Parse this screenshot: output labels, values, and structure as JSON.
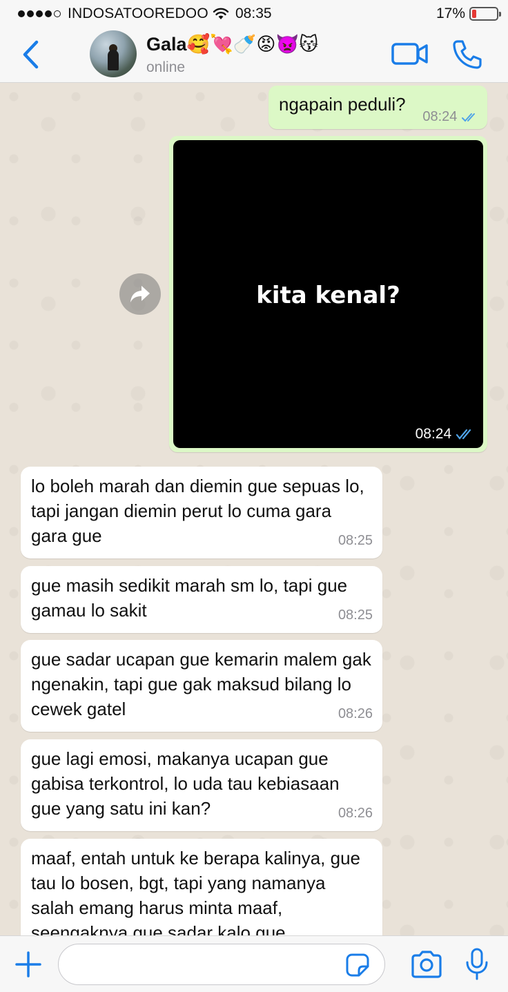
{
  "status_bar": {
    "carrier": "INDOSATOOREDOO",
    "time": "08:35",
    "battery_percent": "17%",
    "battery_level": 0.17
  },
  "header": {
    "contact_name": "Gala🥰💘🍼😡👿😽",
    "contact_status": "online"
  },
  "messages": {
    "out_1": {
      "text": "ngapain peduli?",
      "time": "08:24",
      "status": "read"
    },
    "out_2": {
      "caption": "kita kenal?",
      "time": "08:24",
      "status": "read"
    },
    "in": [
      {
        "text": "lo boleh marah dan diemin gue sepuas lo, tapi jangan diemin perut lo cuma gara gara gue",
        "time": "08:25"
      },
      {
        "text": "gue masih sedikit marah sm lo, tapi gue gamau lo sakit",
        "time": "08:25"
      },
      {
        "text": "gue sadar ucapan gue kemarin malem gak ngenakin, tapi gue gak maksud bilang lo cewek gatel",
        "time": "08:26"
      },
      {
        "text": "gue lagi emosi, makanya ucapan gue gabisa terkontrol, lo uda tau kebiasaan gue yang satu ini kan?",
        "time": "08:26"
      },
      {
        "text": "maaf, entah untuk ke berapa kalinya, gue tau lo bosen, bgt, tapi yang namanya salah emang harus minta maaf, seengaknya gue sadar kalo gue",
        "time": ""
      }
    ]
  },
  "input": {
    "value": "",
    "placeholder": ""
  },
  "colors": {
    "accent": "#1a7de8",
    "outgoing_bubble": "#dcf8c6",
    "incoming_bubble": "#ffffff",
    "chat_background": "#e9e2d8",
    "read_ticks": "#4fa3e8",
    "battery_low": "#e53935"
  },
  "icons": {
    "back": "chevron-left-icon",
    "video": "video-camera-icon",
    "call": "phone-icon",
    "forward": "forward-arrow-icon",
    "plus": "plus-icon",
    "sticker": "sticker-icon",
    "camera": "camera-icon",
    "mic": "microphone-icon",
    "wifi": "wifi-icon",
    "read_receipt": "double-check-icon"
  }
}
